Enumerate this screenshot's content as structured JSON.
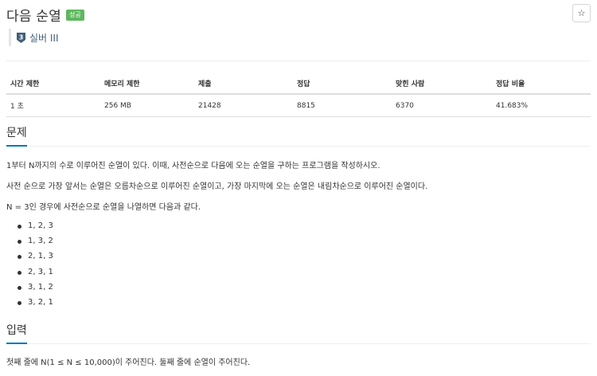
{
  "header": {
    "title": "다음 순열",
    "badge": "성공",
    "star_icon": "star-icon"
  },
  "tier": {
    "icon": "silver-tier-3-icon",
    "icon_number": "3",
    "label": "실버 III",
    "color": "#435f7a"
  },
  "stats": {
    "headers": [
      "시간 제한",
      "메모리 제한",
      "제출",
      "정답",
      "맞힌 사람",
      "정답 비율"
    ],
    "values": [
      "1 초",
      "256 MB",
      "21428",
      "8815",
      "6370",
      "41.683%"
    ]
  },
  "problem": {
    "heading": "문제",
    "paragraphs": [
      "1부터 N까지의 수로 이루어진 순열이 있다. 이때, 사전순으로 다음에 오는 순열을 구하는 프로그램을 작성하시오.",
      "사전 순으로 가장 앞서는 순열은 오름차순으로 이루어진 순열이고, 가장 마지막에 오는 순열은 내림차순으로 이루어진 순열이다.",
      "N = 3인 경우에 사전순으로 순열을 나열하면 다음과 같다."
    ],
    "permutations": [
      "1, 2, 3",
      "1, 3, 2",
      "2, 1, 3",
      "2, 3, 1",
      "3, 1, 2",
      "3, 2, 1"
    ]
  },
  "input": {
    "heading": "입력",
    "text": "첫째 줄에 N(1 ≤ N ≤ 10,000)이 주어진다. 둘째 줄에 순열이 주어진다."
  },
  "colors": {
    "success_badge": "#5cb85c",
    "section_underline": "#0076c0"
  }
}
